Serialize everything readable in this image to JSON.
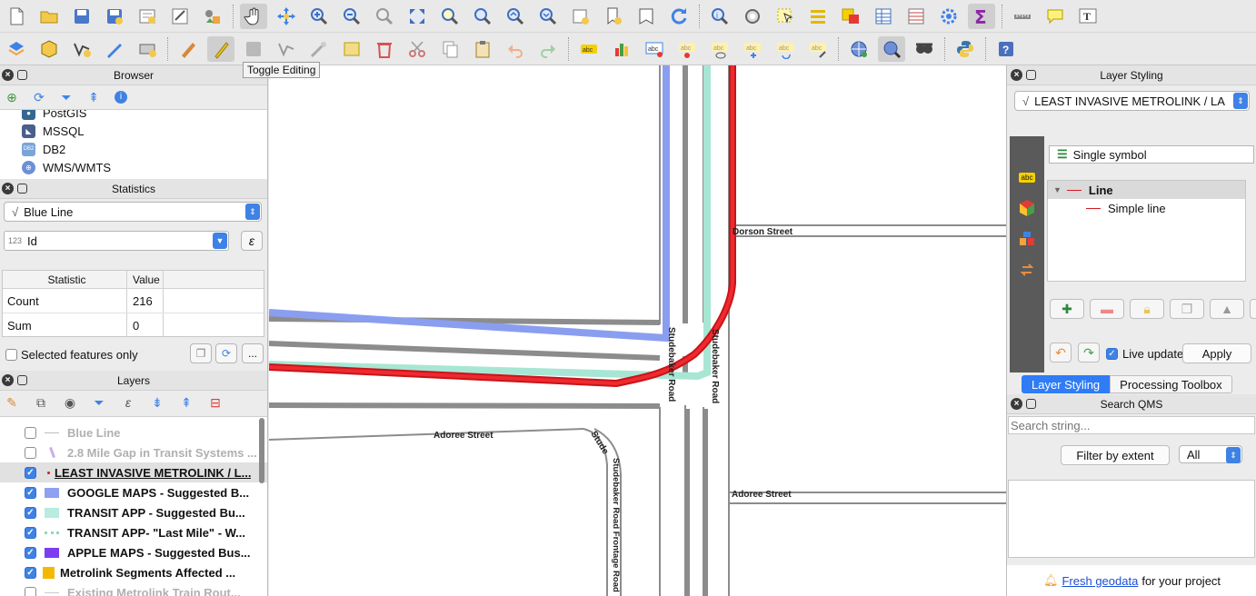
{
  "tooltip": "Toggle Editing",
  "browser": {
    "title": "Browser",
    "items": [
      {
        "label": "PostGIS",
        "icon": "elephant-icon"
      },
      {
        "label": "MSSQL",
        "icon": "mssql-icon"
      },
      {
        "label": "DB2",
        "icon": "db2-icon"
      },
      {
        "label": "WMS/WMTS",
        "icon": "globe-icon"
      }
    ],
    "db2_badge": "DB2"
  },
  "statistics": {
    "title": "Statistics",
    "layer": "Blue Line",
    "field": "Id",
    "field_type": "123",
    "expr_glyph": "ε",
    "col_statistic": "Statistic",
    "col_value": "Value",
    "rows": [
      {
        "statistic": "Count",
        "value": "216"
      },
      {
        "statistic": "Sum",
        "value": "0"
      }
    ],
    "selected_only": "Selected features only",
    "more": "..."
  },
  "layers": {
    "title": "Layers",
    "items": [
      {
        "name": "Blue Line",
        "checked": false,
        "disabled": true,
        "symbol": "line",
        "color": "#bdbdbd"
      },
      {
        "name": "2.8 Mile Gap in Transit Systems ...",
        "checked": false,
        "disabled": true,
        "symbol": "dashed",
        "color": "#c9b0e8"
      },
      {
        "name": "LEAST INVASIVE METROLINK / L...",
        "checked": true,
        "disabled": false,
        "symbol": "dot",
        "color": "#d71920",
        "selected": true
      },
      {
        "name": "GOOGLE MAPS - Suggested B...",
        "checked": true,
        "disabled": false,
        "symbol": "fill",
        "color": "#8ea0f0"
      },
      {
        "name": "TRANSIT APP - Suggested Bu...",
        "checked": true,
        "disabled": false,
        "symbol": "fill",
        "color": "#b7ecde"
      },
      {
        "name": "TRANSIT APP- \"Last Mile\" - W...",
        "checked": true,
        "disabled": false,
        "symbol": "dashed",
        "color": "#8fd9b6"
      },
      {
        "name": "APPLE MAPS - Suggested Bus...",
        "checked": true,
        "disabled": false,
        "symbol": "fill",
        "color": "#7d3cf0"
      },
      {
        "name": "Metrolink Segments Affected ...",
        "checked": true,
        "disabled": false,
        "symbol": "fill",
        "color": "#f5b800"
      },
      {
        "name": "Existing Metrolink Train Rout...",
        "checked": false,
        "disabled": true,
        "symbol": "line",
        "color": "#c9c9c9"
      }
    ]
  },
  "map": {
    "streets": {
      "dorson": "Dorson Street",
      "adoree_left": "Adoree Street",
      "adoree_right": "Adoree Street",
      "studebaker_1": "Studebaker Road",
      "studebaker_2": "Studebaker Road",
      "studebaker_frontage": "Studebaker Road Frontage Road"
    },
    "colors": {
      "red": "#e0141c",
      "blue": "#8a9ef0",
      "teal": "#a8e6d4",
      "gray": "#8c8c8c"
    }
  },
  "layer_styling": {
    "title": "Layer Styling",
    "layer": "LEAST INVASIVE METROLINK / LA",
    "renderer": "Single symbol",
    "tree": {
      "root": "Line",
      "child": "Simple line"
    },
    "live_update": "Live update",
    "apply": "Apply",
    "tabs": [
      "Layer Styling",
      "Processing Toolbox"
    ]
  },
  "qms": {
    "title": "Search QMS",
    "placeholder": "Search string...",
    "filter": "Filter by extent",
    "scope": "All",
    "footer_link": "Fresh geodata",
    "footer_text": "for your project"
  }
}
